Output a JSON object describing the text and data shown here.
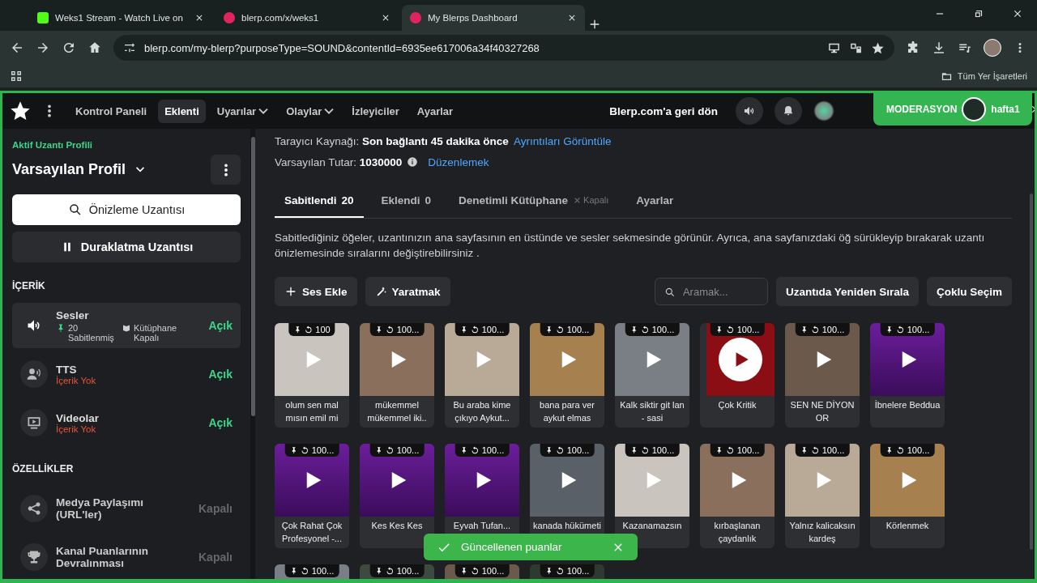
{
  "browser": {
    "tabs": [
      {
        "title": "Weks1 Stream - Watch Live on ",
        "kind": "kick",
        "selected": false
      },
      {
        "title": "blerp.com/x/weks1",
        "kind": "blerp",
        "selected": false
      },
      {
        "title": "My Blerps Dashboard",
        "kind": "blerp",
        "selected": true
      }
    ],
    "url": "blerp.com/my-blerp?purposeType=SOUND&contentId=6935ee617006a34f40327268",
    "bookmarks_label": "Tüm Yer İşaretleri"
  },
  "nav": {
    "items": [
      {
        "label": "Kontrol Paneli",
        "dropdown": false,
        "selected": false
      },
      {
        "label": "Eklenti",
        "dropdown": false,
        "selected": true
      },
      {
        "label": "Uyarılar",
        "dropdown": true,
        "selected": false
      },
      {
        "label": "Olaylar",
        "dropdown": true,
        "selected": false
      },
      {
        "label": "İzleyiciler",
        "dropdown": false,
        "selected": false
      },
      {
        "label": "Ayarlar",
        "dropdown": false,
        "selected": false
      }
    ],
    "back_link": "Blerp.com'a geri dön",
    "moderation": "MODERASYON",
    "username": "hafta1"
  },
  "sidebar": {
    "profile_caption": "Aktif Uzantı Profili",
    "profile_name": "Varsayılan Profil",
    "preview_button": "Önizleme Uzantısı",
    "pause_button": "Duraklatma Uzantısı",
    "content_heading": "İÇERİK",
    "content_items": [
      {
        "kind": "sounds",
        "name": "Sesler",
        "pinned": "20 Sabitlenmiş",
        "library": "Kütüphane Kapalı",
        "status": "Açık",
        "enabled": true,
        "selected": true
      },
      {
        "kind": "tts",
        "name": "TTS",
        "note": "İçerik Yok",
        "status": "Açık",
        "enabled": true,
        "selected": false
      },
      {
        "kind": "videos",
        "name": "Videolar",
        "note": "İçerik Yok",
        "status": "Açık",
        "enabled": true,
        "selected": false
      }
    ],
    "features_heading": "ÖZELLİKLER",
    "features": [
      {
        "kind": "share",
        "name": "Medya Paylaşımı (URL'ler)",
        "status": "Kapalı",
        "enabled": false
      },
      {
        "kind": "trophy",
        "name": "Kanal Puanlarının Devralınması",
        "status": "Kapalı",
        "enabled": false
      }
    ]
  },
  "main": {
    "source": "Tarayıcı Kaynağı: **Son bağlantı 45 dakika önce**",
    "source_link": "Ayrıntıları Görüntüle",
    "amount": "Varsayılan Tutar: **1030000**",
    "amount_link": "Düzenlemek",
    "tabs": [
      {
        "label": "Sabitlendi",
        "count": "20",
        "selected": true
      },
      {
        "label": "Eklendi",
        "count": "0",
        "selected": false
      },
      {
        "label": "Denetimli Kütüphane",
        "status": "Kapalı",
        "selected": false
      },
      {
        "label": "Ayarlar",
        "selected": false
      }
    ],
    "description": "Sabitlediğiniz öğeler, uzantınızın ana sayfasının en üstünde ve sesler sekmesinde görünür. Ayrıca, ana sayfanızdaki öğ sürükleyip bırakarak uzantı önizlemesinde sıralarını değiştirebilirsiniz .",
    "add_button": "Ses Ekle",
    "create_button": "Yaratmak",
    "search": {
      "placeholder": "Aramak..."
    },
    "reorder_button": "Uzantıda Yeniden Sırala",
    "multi_button": "Çoklu Seçim",
    "sounds": [
      {
        "count": "100",
        "title": "olum sen mal mısın emil mi",
        "kind": "photo"
      },
      {
        "count": "100...",
        "title": "mükemmel mükemmel iki..",
        "kind": "photo"
      },
      {
        "count": "100...",
        "title": "Bu araba kime çıkıyo Aykut...",
        "kind": "photo"
      },
      {
        "count": "100...",
        "title": "bana para ver aykut elmas",
        "kind": "photo"
      },
      {
        "count": "100...",
        "title": "Kalk siktir git lan - sasi",
        "kind": "photo"
      },
      {
        "count": "100...",
        "title": "Çok Kritik",
        "kind": "logo"
      },
      {
        "count": "100...",
        "title": "SEN NE DİYON OR",
        "kind": "photo"
      },
      {
        "count": "100...",
        "title": "İbnelere Beddua",
        "kind": "effects"
      },
      {
        "count": "100...",
        "title": "Çok Rahat Çok Profesyonel -...",
        "kind": "effects"
      },
      {
        "count": "100...",
        "title": "Kes Kes Kes",
        "kind": "effects"
      },
      {
        "count": "100...",
        "title": "Eyvah Tufan...",
        "kind": "effects"
      },
      {
        "count": "100...",
        "title": "kanada hükümeti",
        "kind": "photo"
      },
      {
        "count": "100...",
        "title": "Kazanamazsın",
        "kind": "photo"
      },
      {
        "count": "100...",
        "title": "kırbaşlanan çaydanlık",
        "kind": "photo"
      },
      {
        "count": "100...",
        "title": "Yalnız kalicaksın kardeş",
        "kind": "photo"
      },
      {
        "count": "100...",
        "title": "Körlenmek",
        "kind": "photo"
      },
      {
        "count": "100...",
        "kind": "photo"
      },
      {
        "count": "100...",
        "kind": "photo"
      },
      {
        "count": "100...",
        "kind": "photo"
      },
      {
        "count": "100...",
        "kind": "photo"
      }
    ],
    "toast": "Güncellenen puanlar"
  }
}
